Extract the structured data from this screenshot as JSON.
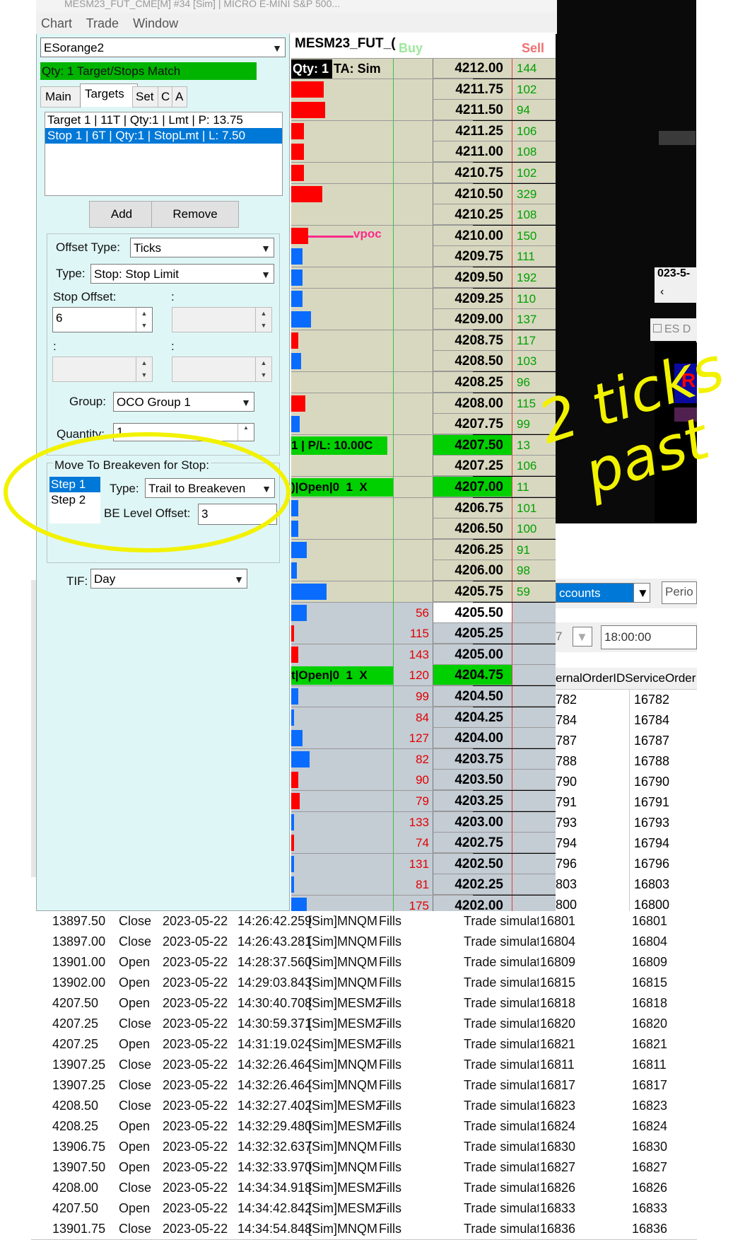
{
  "window": {
    "title": "MESM23_FUT_CME[M] #34 [Sim] | MICRO E-MINI S&P 500...",
    "menu": [
      "Chart",
      "Trade",
      "Window"
    ]
  },
  "strategy": {
    "selected": "ESorange2",
    "status": "Qty: 1 Target/Stops Match"
  },
  "tabs": [
    "Main",
    "Targets",
    "Set",
    "C",
    "A"
  ],
  "targets_list": [
    "Target 1 | 11T | Qty:1 | Lmt | P: 13.75",
    "Stop 1 | 6T | Qty:1 | StopLmt | L: 7.50"
  ],
  "buttons": {
    "add": "Add",
    "remove": "Remove"
  },
  "offset": {
    "offset_type_label": "Offset Type:",
    "offset_type_value": "Ticks",
    "type_label": "Type:",
    "type_value": "Stop: Stop Limit",
    "stop_offset_label": "Stop Offset:",
    "stop_offset_value": "6",
    "colon": ":"
  },
  "group": {
    "label": "Group:",
    "value": "OCO Group 1"
  },
  "quantity": {
    "label": "Quantity:",
    "value": "1"
  },
  "breakeven": {
    "title": "Move To Breakeven for Stop:",
    "steps": [
      "Step 1",
      "Step 2"
    ],
    "type_label": "Type:",
    "type_value": "Trail to Breakeven",
    "be_label": "BE Level Offset:",
    "be_value": "3"
  },
  "tif": {
    "label": "TIF:",
    "value": "Day"
  },
  "ladder": {
    "header_symbol": "MESM23_FUT_(",
    "header_buy": "Buy",
    "header_sell": "Sell",
    "qty_label": "Qty: 1",
    "ta_label": "TA: Sim",
    "vpoc": "vpoc",
    "pl_label": "1 | P/L: 10.00C",
    "open_label_1": ")|Open|0  1  X",
    "open_label_2": "t|Open|0  1  X",
    "rows": [
      {
        "price": "4212.00",
        "sell": "144"
      },
      {
        "price": "4211.75",
        "sell": "102"
      },
      {
        "price": "4211.50",
        "sell": "94"
      },
      {
        "price": "4211.25",
        "sell": "106"
      },
      {
        "price": "4211.00",
        "sell": "108"
      },
      {
        "price": "4210.75",
        "sell": "102"
      },
      {
        "price": "4210.50",
        "sell": "329"
      },
      {
        "price": "4210.25",
        "sell": "108"
      },
      {
        "price": "4210.00",
        "sell": "150"
      },
      {
        "price": "4209.75",
        "sell": "111"
      },
      {
        "price": "4209.50",
        "sell": "192"
      },
      {
        "price": "4209.25",
        "sell": "110"
      },
      {
        "price": "4209.00",
        "sell": "137"
      },
      {
        "price": "4208.75",
        "sell": "117"
      },
      {
        "price": "4208.50",
        "sell": "103"
      },
      {
        "price": "4208.25",
        "sell": "96"
      },
      {
        "price": "4208.00",
        "sell": "115"
      },
      {
        "price": "4207.75",
        "sell": "99"
      },
      {
        "price": "4207.50",
        "sell": "13"
      },
      {
        "price": "4207.25",
        "sell": "106"
      },
      {
        "price": "4207.00",
        "sell": "11"
      },
      {
        "price": "4206.75",
        "sell": "101"
      },
      {
        "price": "4206.50",
        "sell": "100"
      },
      {
        "price": "4206.25",
        "sell": "91"
      },
      {
        "price": "4206.00",
        "sell": "98"
      },
      {
        "price": "4205.75",
        "sell": "59"
      },
      {
        "price": "4205.50",
        "buy": "56"
      },
      {
        "price": "4205.25",
        "buy": "115"
      },
      {
        "price": "4205.00",
        "buy": "143"
      },
      {
        "price": "4204.75",
        "buy": "120"
      },
      {
        "price": "4204.50",
        "buy": "99"
      },
      {
        "price": "4204.25",
        "buy": "84"
      },
      {
        "price": "4204.00",
        "buy": "127"
      },
      {
        "price": "4203.75",
        "buy": "82"
      },
      {
        "price": "4203.50",
        "buy": "90"
      },
      {
        "price": "4203.25",
        "buy": "79"
      },
      {
        "price": "4203.00",
        "buy": "133"
      },
      {
        "price": "4202.75",
        "buy": "74"
      },
      {
        "price": "4202.50",
        "buy": "131"
      },
      {
        "price": "4202.25",
        "buy": "81"
      },
      {
        "price": "4202.00",
        "buy": "175"
      }
    ]
  },
  "right_panel": {
    "date_fragment": "023-5-",
    "es_label": "ES D",
    "accounts": "ccounts",
    "period": "Perio",
    "time": "18:00:00",
    "col_header": "ernalOrderIDServiceOrder",
    "small_num": "7"
  },
  "orders": [
    {
      "c": "782",
      "d": "16782"
    },
    {
      "c": "784",
      "d": "16784"
    },
    {
      "c": "787",
      "d": "16787"
    },
    {
      "c": "788",
      "d": "16788"
    },
    {
      "c": "790",
      "d": "16790"
    },
    {
      "c": "791",
      "d": "16791"
    },
    {
      "c": "793",
      "d": "16793"
    },
    {
      "c": "794",
      "d": "16794"
    },
    {
      "c": "796",
      "d": "16796"
    },
    {
      "c": "803",
      "d": "16803"
    },
    {
      "c": "800",
      "d": "16800"
    }
  ],
  "fills": [
    {
      "price": "13897.50",
      "action": "Close",
      "date": "2023-05-22",
      "time": "14:26:42.259",
      "acct": "[Sim]MNQM",
      "type": "Fills",
      "text": "Trade simulatio",
      "id1": "16801",
      "id2": "16801"
    },
    {
      "price": "13897.00",
      "action": "Close",
      "date": "2023-05-22",
      "time": "14:26:43.281",
      "acct": "[Sim]MNQM",
      "type": "Fills",
      "text": "Trade simulatio",
      "id1": "16804",
      "id2": "16804"
    },
    {
      "price": "13901.00",
      "action": "Open",
      "date": "2023-05-22",
      "time": "14:28:37.560",
      "acct": "[Sim]MNQM",
      "type": "Fills",
      "text": "Trade simulatio",
      "id1": "16809",
      "id2": "16809"
    },
    {
      "price": "13902.00",
      "action": "Open",
      "date": "2023-05-22",
      "time": "14:29:03.843",
      "acct": "[Sim]MNQM",
      "type": "Fills",
      "text": "Trade simulatio",
      "id1": "16815",
      "id2": "16815"
    },
    {
      "price": "4207.50",
      "action": "Open",
      "date": "2023-05-22",
      "time": "14:30:40.708",
      "acct": "[Sim]MESM2",
      "type": "Fills",
      "text": "Trade simulatio",
      "id1": "16818",
      "id2": "16818"
    },
    {
      "price": "4207.25",
      "action": "Close",
      "date": "2023-05-22",
      "time": "14:30:59.371",
      "acct": "[Sim]MESM2",
      "type": "Fills",
      "text": "Trade simulatio",
      "id1": "16820",
      "id2": "16820"
    },
    {
      "price": "4207.25",
      "action": "Open",
      "date": "2023-05-22",
      "time": "14:31:19.024",
      "acct": "[Sim]MESM2",
      "type": "Fills",
      "text": "Trade simulatio",
      "id1": "16821",
      "id2": "16821"
    },
    {
      "price": "13907.25",
      "action": "Close",
      "date": "2023-05-22",
      "time": "14:32:26.464",
      "acct": "[Sim]MNQM",
      "type": "Fills",
      "text": "Trade simulatio",
      "id1": "16811",
      "id2": "16811"
    },
    {
      "price": "13907.25",
      "action": "Close",
      "date": "2023-05-22",
      "time": "14:32:26.464",
      "acct": "[Sim]MNQM",
      "type": "Fills",
      "text": "Trade simulatio",
      "id1": "16817",
      "id2": "16817"
    },
    {
      "price": "4208.50",
      "action": "Close",
      "date": "2023-05-22",
      "time": "14:32:27.402",
      "acct": "[Sim]MESM2",
      "type": "Fills",
      "text": "Trade simulatio",
      "id1": "16823",
      "id2": "16823"
    },
    {
      "price": "4208.25",
      "action": "Open",
      "date": "2023-05-22",
      "time": "14:32:29.480",
      "acct": "[Sim]MESM2",
      "type": "Fills",
      "text": "Trade simulatio",
      "id1": "16824",
      "id2": "16824"
    },
    {
      "price": "13906.75",
      "action": "Open",
      "date": "2023-05-22",
      "time": "14:32:32.637",
      "acct": "[Sim]MNQM",
      "type": "Fills",
      "text": "Trade simulatio",
      "id1": "16830",
      "id2": "16830"
    },
    {
      "price": "13907.50",
      "action": "Open",
      "date": "2023-05-22",
      "time": "14:32:33.970",
      "acct": "[Sim]MNQM",
      "type": "Fills",
      "text": "Trade simulatio",
      "id1": "16827",
      "id2": "16827"
    },
    {
      "price": "4208.00",
      "action": "Close",
      "date": "2023-05-22",
      "time": "14:34:34.918",
      "acct": "[Sim]MESM2",
      "type": "Fills",
      "text": "Trade simulatio",
      "id1": "16826",
      "id2": "16826"
    },
    {
      "price": "4207.50",
      "action": "Open",
      "date": "2023-05-22",
      "time": "14:34:42.842",
      "acct": "[Sim]MESM2",
      "type": "Fills",
      "text": "Trade simulatio",
      "id1": "16833",
      "id2": "16833"
    },
    {
      "price": "13901.75",
      "action": "Close",
      "date": "2023-05-22",
      "time": "14:34:54.848",
      "acct": "[Sim]MNQM",
      "type": "Fills",
      "text": "Trade simulatio",
      "id1": "16836",
      "id2": "16836"
    }
  ],
  "annotation": {
    "line1": "2 ticks",
    "line2": "past"
  },
  "colors": {
    "panel_bg": "#dff6f6",
    "status_green": "#00b400",
    "ask_red": "#ff0000",
    "bid_blue": "#0a6cff",
    "sell_text_green": "#00a000",
    "buy_text_red": "#e00000",
    "highlight_yellow": "#f2f200",
    "ladder_upper": "#d8d8c0",
    "ladder_lower": "#c4ccd4"
  }
}
